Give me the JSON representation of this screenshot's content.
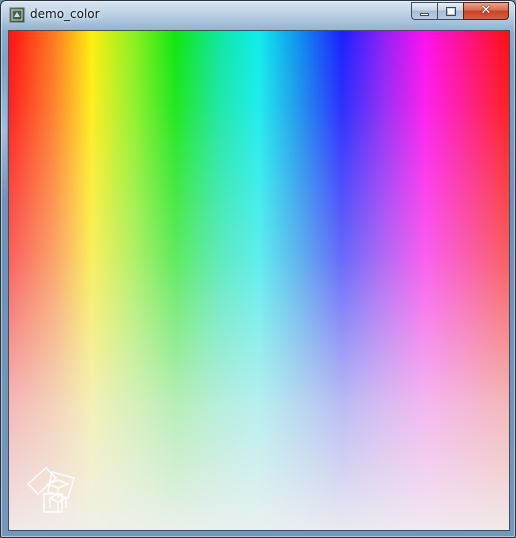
{
  "window": {
    "title": "demo_color",
    "app_icon": "app-icon",
    "caption_buttons": {
      "minimize_icon": "minimize-icon",
      "maximize_icon": "maximize-icon",
      "close_glyph": "✕"
    }
  },
  "canvas": {
    "content": "color-spectrum",
    "hue_stops": [
      "#ff1010",
      "#ffee10",
      "#10e610",
      "#10ecec",
      "#1c20ff",
      "#ff10ee",
      "#ff1010"
    ],
    "fade_to": "#f0f0f0",
    "watermark_icon": "cube-logo-icon"
  }
}
